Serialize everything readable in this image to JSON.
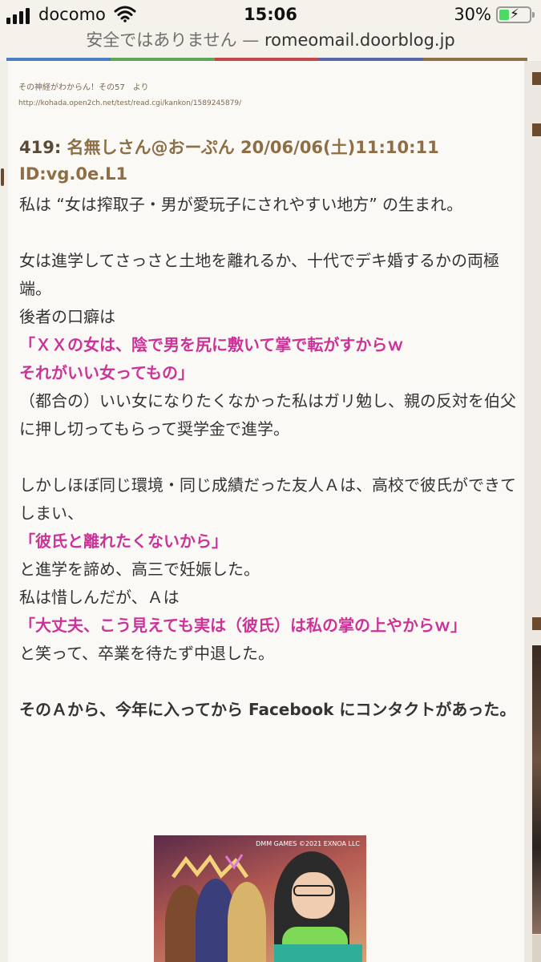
{
  "status_bar": {
    "carrier": "docomo",
    "time": "15:06",
    "battery_percent": "30%",
    "battery_level": 0.3,
    "signal_icon": "signal-bars-icon",
    "wifi_icon": "wifi-icon",
    "battery_icon": "battery-charging-icon"
  },
  "address_bar": {
    "security_text": "安全ではありません",
    "separator": "—",
    "domain": "romeomail.doorblog.jp"
  },
  "colors": {
    "page_bg": "#f5f2ec",
    "header_color": "#8d6e45",
    "highlight_pink": "#cc3399",
    "strip": [
      "#4a7fc1",
      "#5fa55a",
      "#c04848",
      "#5566aa",
      "#8d6e45"
    ]
  },
  "article": {
    "source_title": "その神経がわからん！その57　より",
    "source_url": "http://kohada.open2ch.net/test/read.cgi/kankon/1589245879/",
    "post_number": "419:",
    "post_name": "名無しさん@おーぷん",
    "post_date": "20/06/06(土)11:10:11 ID:vg.0e.L1",
    "lines": {
      "l1": "私は “女は搾取子・男が愛玩子にされやすい地方” の生まれ。",
      "l2": "女は進学してさっさと土地を離れるか、十代でデキ婚するかの両極端。",
      "l3": "後者の口癖は",
      "l4": "「ＸＸの女は、陰で男を尻に敷いて掌で転がすからｗ",
      "l5": "それがいい女ってもの」",
      "l6": "（都合の）いい女になりたくなかった私はガリ勉し、親の反対を伯父に押し切ってもらって奨学金で進学。",
      "l7": "しかしほぼ同じ環境・同じ成績だった友人Ａは、高校で彼氏ができてしまい、",
      "l8": "「彼氏と離れたくないから」",
      "l9": "と進学を諦め、高三で妊娠した。",
      "l10": "私は惜しんだが、Ａは",
      "l11": "「大丈夫、こう見えても実は（彼氏）は私の掌の上やからｗ」",
      "l12": "と笑って、卒業を待たず中退した。",
      "l13": "そのＡから、今年に入ってから Facebook にコンタクトがあった。"
    }
  },
  "ad": {
    "brand": "DMM GAMES ©2021 EXNOA LLC"
  }
}
